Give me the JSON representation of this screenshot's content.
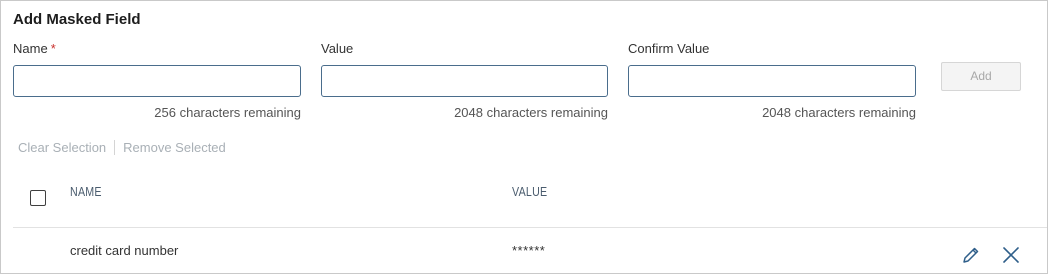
{
  "title": "Add Masked Field",
  "form": {
    "name": {
      "label": "Name",
      "required_mark": "*",
      "value": "",
      "remaining": "256 characters remaining"
    },
    "value": {
      "label": "Value",
      "value": "",
      "remaining": "2048 characters remaining"
    },
    "confirm": {
      "label": "Confirm Value",
      "value": "",
      "remaining": "2048 characters remaining"
    },
    "add_label": "Add"
  },
  "selection": {
    "clear_label": "Clear Selection",
    "remove_label": "Remove Selected"
  },
  "table": {
    "headers": [
      "NAME",
      "VALUE"
    ],
    "rows": [
      {
        "name": "credit card number",
        "value": "******"
      }
    ]
  },
  "colors": {
    "input_border": "#4a6d8c",
    "required": "#c9302c",
    "icon": "#2f5f8a",
    "disabled_text": "#a9b0b6"
  }
}
